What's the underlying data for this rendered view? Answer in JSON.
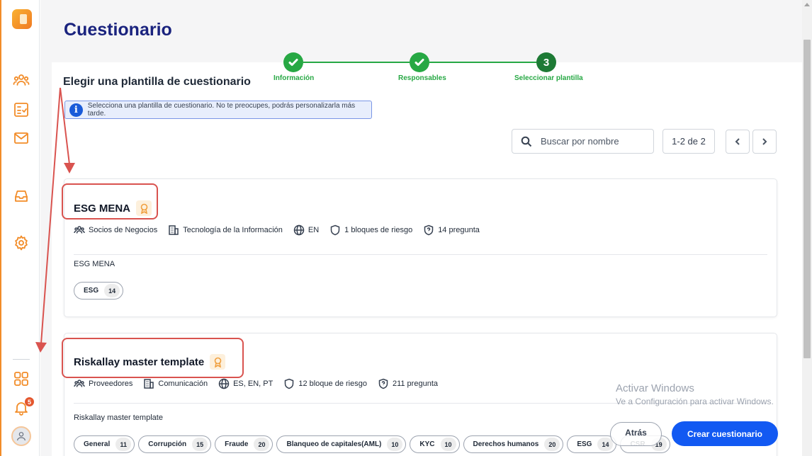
{
  "page": {
    "title": "Cuestionario",
    "section_title": "Elegir una plantilla de cuestionario",
    "info": "Selecciona una plantilla de cuestionario. No te preocupes, podrás personalizarla más tarde."
  },
  "stepper": {
    "steps": [
      {
        "label": "Información",
        "state": "done"
      },
      {
        "label": "Responsables",
        "state": "done"
      },
      {
        "label": "Seleccionar plantilla",
        "state": "current",
        "number": "3"
      }
    ]
  },
  "search": {
    "placeholder": "Buscar por nombre"
  },
  "pagination": {
    "range": "1-2 de 2"
  },
  "templates": [
    {
      "name": "ESG MENA",
      "audience": "Socios de Negocios",
      "sector": "Tecnología de la Información",
      "languages": "EN",
      "blocks": "1 bloques de riesgo",
      "questions": "14 pregunta",
      "description": "ESG MENA",
      "tags": [
        {
          "label": "ESG",
          "count": "14"
        }
      ]
    },
    {
      "name": "Riskallay master template",
      "audience": "Proveedores",
      "sector": "Comunicación",
      "languages": "ES, EN, PT",
      "blocks": "12 bloque de riesgo",
      "questions": "211 pregunta",
      "description": "Riskallay master template",
      "tags": [
        {
          "label": "General",
          "count": "11"
        },
        {
          "label": "Corrupción",
          "count": "15"
        },
        {
          "label": "Fraude",
          "count": "20"
        },
        {
          "label": "Blanqueo de capitales(AML)",
          "count": "10"
        },
        {
          "label": "KYC",
          "count": "10"
        },
        {
          "label": "Derechos humanos",
          "count": "20"
        },
        {
          "label": "ESG",
          "count": "14"
        },
        {
          "label": "CSR",
          "count": "19"
        }
      ]
    }
  ],
  "actions": {
    "back": "Atrás",
    "create": "Crear cuestionario"
  },
  "notifications": {
    "count": "5"
  },
  "watermark": {
    "line1": "Activar Windows",
    "line2": "Ve a Configuración para activar Windows."
  },
  "colors": {
    "accent": "#f28c28",
    "primary": "#1259f2",
    "success": "#27a844",
    "title": "#1a237e",
    "highlight": "#d9534f"
  }
}
